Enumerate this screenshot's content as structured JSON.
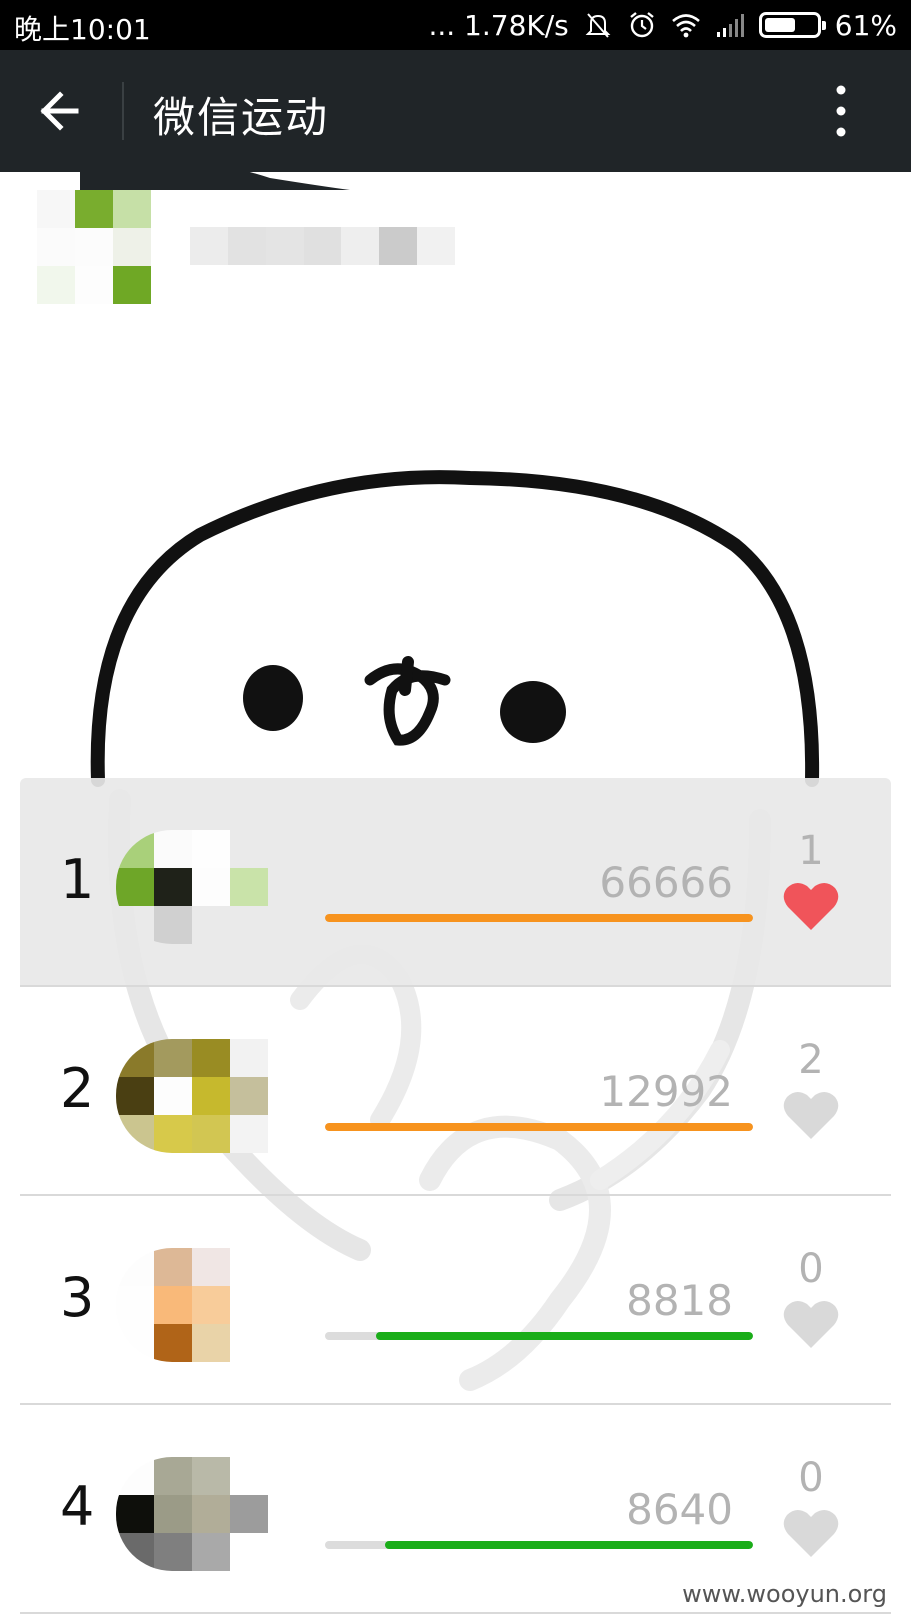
{
  "status_bar": {
    "time": "晚上10:01",
    "network_speed": "... 1.78K/s",
    "battery_percent": "61%",
    "battery_level": 0.61,
    "icons": [
      "mute-bell-icon",
      "alarm-icon",
      "wifi-icon",
      "signal-icon",
      "battery-icon"
    ]
  },
  "header": {
    "title": "微信运动",
    "back_icon": "back-arrow-icon",
    "menu_icon": "more-vertical-icon"
  },
  "colors": {
    "titlebar": "#202528",
    "orange_bar": "#f7931e",
    "green_bar": "#1aad19",
    "liked_heart": "#f0545a",
    "unliked_heart": "#d9d9d9"
  },
  "ranking": [
    {
      "rank": "1",
      "steps": "66666",
      "progress": 1.0,
      "bar_color": "orange",
      "likes": "1",
      "liked": true,
      "highlight": true
    },
    {
      "rank": "2",
      "steps": "12992",
      "progress": 1.0,
      "bar_color": "orange",
      "likes": "2",
      "liked": false,
      "highlight": false
    },
    {
      "rank": "3",
      "steps": "8818",
      "progress": 0.88,
      "bar_color": "green",
      "likes": "0",
      "liked": false,
      "highlight": false
    },
    {
      "rank": "4",
      "steps": "8640",
      "progress": 0.86,
      "bar_color": "green",
      "likes": "0",
      "liked": false,
      "highlight": false
    }
  ],
  "watermark": "www.wooyun.org"
}
